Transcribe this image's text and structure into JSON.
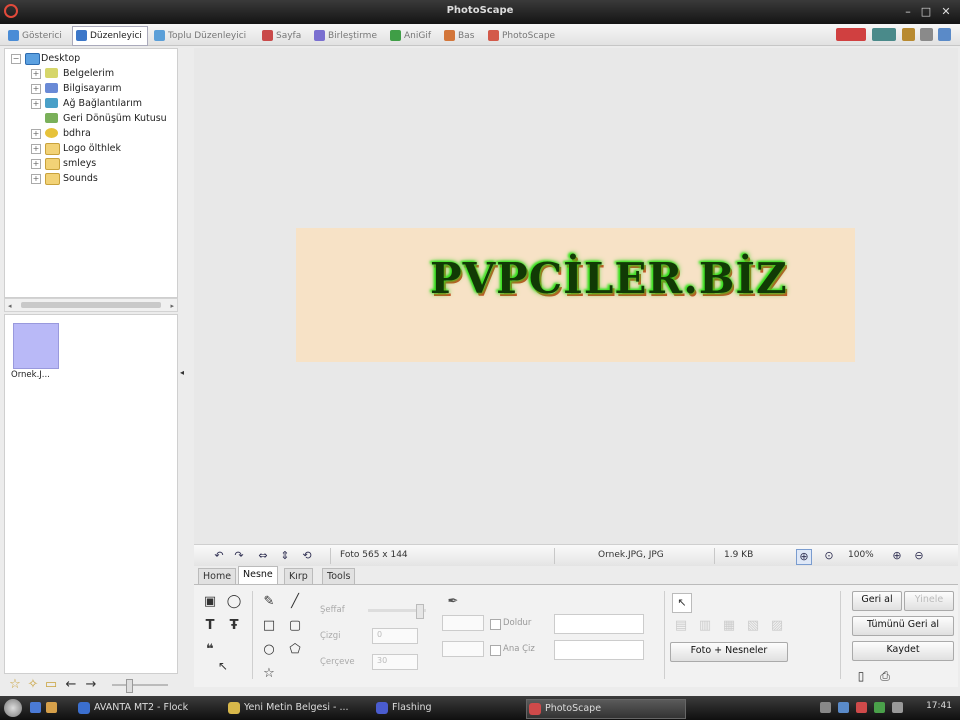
{
  "window": {
    "title": "PhotoScape",
    "minimize_icon": "minimize-icon",
    "maximize_icon": "maximize-icon",
    "close_icon": "close-icon"
  },
  "tabs": [
    {
      "label": "Gösterici",
      "color": "#4a8cd6"
    },
    {
      "label": "Düzenleyici",
      "color": "#3c77c9",
      "active": true
    },
    {
      "label": "Toplu Düzenleyici",
      "color": "#5b9fd8"
    },
    {
      "label": "Sayfa",
      "color": "#c94a4a"
    },
    {
      "label": "Birleştirme",
      "color": "#7a6fd0"
    },
    {
      "label": "AniGif",
      "color": "#3f9e46"
    },
    {
      "label": "Bas",
      "color": "#d3763a"
    },
    {
      "label": "PhotoScape",
      "color": "#d35a4a"
    }
  ],
  "tree": {
    "root": "Desktop",
    "items": [
      "Belgelerim",
      "Bilgisayarım",
      "Ağ Bağlantılarım",
      "Geri Dönüşüm Kutusu",
      "bdhra",
      "Logo ölthlek",
      "smleys",
      "Sounds"
    ]
  },
  "thumbnail": {
    "label": "Ornek.J..."
  },
  "photo": {
    "text": "PVPCİLER.BİZ"
  },
  "statusbar": {
    "photo_size": "Foto 565 x 144",
    "filename": "Ornek.JPG, JPG",
    "filesize": "1.9 KB",
    "zoom": "100%"
  },
  "bottom_tabs": [
    "Home",
    "Nesne",
    "Kırp",
    "Tools"
  ],
  "object_panel": {
    "opacity_label": "Şeffaf",
    "thickness_label": "Çizgi",
    "thickness_value": "0",
    "round_label": "Çerçeve",
    "round_value": "30",
    "fill_label": "Doldur",
    "shadow_label": "Ana Çiz",
    "photo_objects_button": "Foto + Nesneler"
  },
  "action_buttons": {
    "undo": "Geri al",
    "redo": "Yinele",
    "undo_all": "Tümünü Geri al",
    "save": "Kaydet"
  },
  "taskbar": {
    "items": [
      {
        "label": "AVANTA MT2 - Flock",
        "color": "#3b6fcf"
      },
      {
        "label": "Yeni Metin Belgesi - ...",
        "color": "#d8b84a"
      },
      {
        "label": "Flashing",
        "color": "#4a5ccf"
      },
      {
        "label": "PhotoScape",
        "color": "#cf4a4a",
        "active": true
      }
    ],
    "clock": "17:41"
  }
}
